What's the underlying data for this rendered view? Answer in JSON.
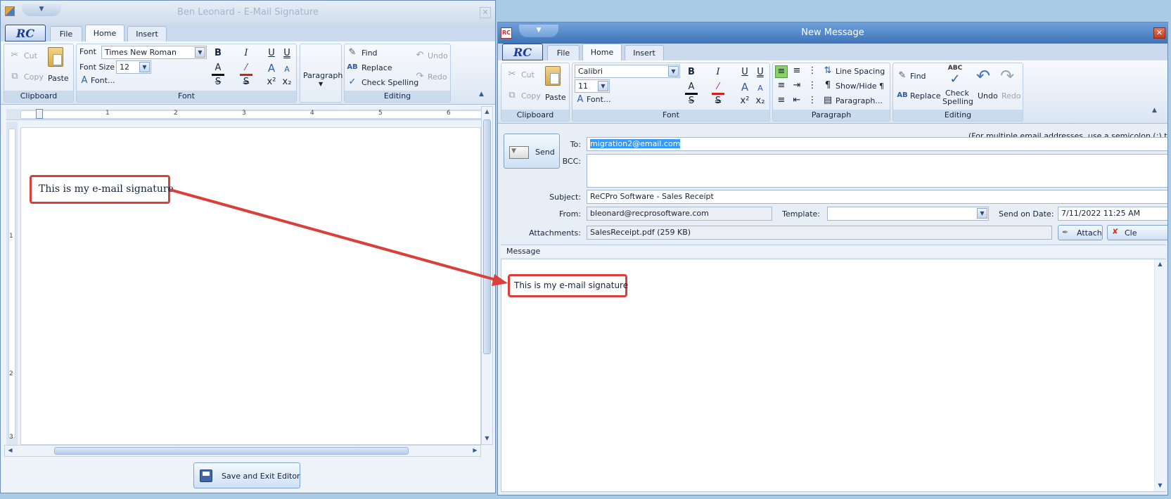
{
  "left": {
    "title": "Ben Leonard - E-Mail Signature",
    "tabs": [
      "File",
      "Home",
      "Insert"
    ],
    "clipboard": {
      "cut": "Cut",
      "copy": "Copy",
      "paste": "Paste",
      "group": "Clipboard"
    },
    "font": {
      "font_label": "Font",
      "font_value": "Times New Roman",
      "size_label": "Font Size",
      "size_value": "12",
      "dialog": "Font...",
      "group": "Font"
    },
    "paragraph": "Paragraph",
    "editing": {
      "find": "Find",
      "replace": "Replace",
      "check": "Check Spelling",
      "undo": "Undo",
      "redo": "Redo",
      "group": "Editing"
    },
    "ruler": [
      "1",
      "2",
      "3",
      "4",
      "5",
      "6"
    ],
    "vruler": [
      "1",
      "2",
      "3"
    ],
    "callout": "This is my e-mail signature",
    "save_btn": "Save and Exit Editor"
  },
  "right": {
    "title": "New Message",
    "tabs": [
      "File",
      "Home",
      "Insert"
    ],
    "clipboard": {
      "cut": "Cut",
      "copy": "Copy",
      "paste": "Paste",
      "group": "Clipboard"
    },
    "font": {
      "font_value": "Calibri",
      "size_value": "11",
      "dialog": "Font...",
      "group": "Font"
    },
    "paragraph": {
      "line_spacing": "Line Spacing",
      "show_hide": "Show/Hide ¶",
      "dialog": "Paragraph...",
      "group": "Paragraph"
    },
    "editing": {
      "find": "Find",
      "replace": "Replace",
      "check1": "Check",
      "check2": "Spelling",
      "undo": "Undo",
      "redo": "Redo",
      "group": "Editing"
    },
    "hint": "(For multiple email addresses, use a semicolon (;) to sepa",
    "send": "Send",
    "to_label": "To:",
    "to_value": "migration2@email.com",
    "bcc_label": "BCC:",
    "subject_label": "Subject:",
    "subject_value": "ReCPro Software - Sales Receipt",
    "from_label": "From:",
    "from_value": "bleonard@recprosoftware.com",
    "template_label": "Template:",
    "send_on_label": "Send on Date:",
    "send_on_value": "7/11/2022 11:25 AM",
    "attach_label": "Attachments:",
    "attach_value": "SalesReceipt.pdf (259 KB)",
    "attach_btn": "Attach",
    "clear_btn": "Cle",
    "message_label": "Message",
    "callout": "This is my e-mail signature"
  },
  "colors": {
    "callout_border": "#d9403b",
    "title_active": "#3e74b9",
    "selection": "#3399ff"
  },
  "logo_text": "RC"
}
